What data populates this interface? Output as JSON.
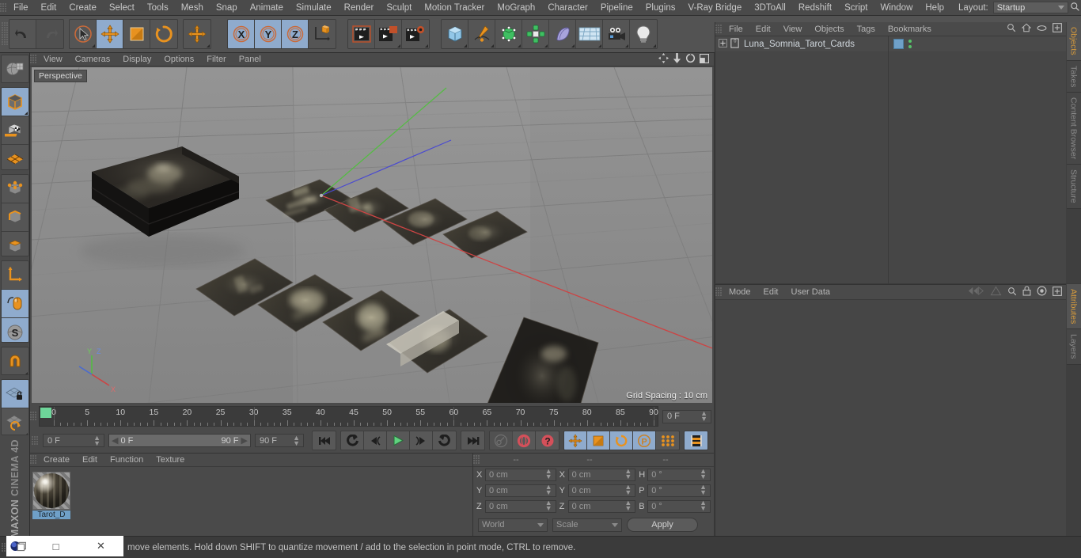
{
  "app": {
    "title": "MAXON CINEMA 4D",
    "brand_top": "MAXON",
    "brand_bottom": "CINEMA 4D"
  },
  "menubar": {
    "items": [
      "File",
      "Edit",
      "Create",
      "Select",
      "Tools",
      "Mesh",
      "Snap",
      "Animate",
      "Simulate",
      "Render",
      "Sculpt",
      "Motion Tracker",
      "MoGraph",
      "Character",
      "Pipeline",
      "Plugins",
      "V-Ray Bridge",
      "3DToAll",
      "Redshift",
      "Script",
      "Window",
      "Help"
    ],
    "layout_label": "Layout:",
    "layout_value": "Startup",
    "search_icon": "search-icon"
  },
  "toolbar": {
    "groups": [
      {
        "name": "history",
        "buttons": [
          {
            "name": "undo-button",
            "icon": "undo-icon",
            "state": "normal"
          },
          {
            "name": "redo-button",
            "icon": "redo-icon",
            "state": "disabled"
          }
        ]
      },
      {
        "name": "select-transform",
        "buttons": [
          {
            "name": "live-selection-button",
            "icon": "live-selection-icon",
            "state": "normal"
          },
          {
            "name": "move-button",
            "icon": "move-icon",
            "state": "active"
          },
          {
            "name": "scale-button",
            "icon": "scale-icon",
            "state": "normal"
          },
          {
            "name": "rotate-button",
            "icon": "rotate-icon",
            "state": "normal"
          }
        ]
      },
      {
        "name": "move-alt",
        "buttons": [
          {
            "name": "move-alt-button",
            "icon": "move-icon",
            "state": "normal"
          }
        ]
      },
      {
        "name": "axis-locks",
        "buttons": [
          {
            "name": "lock-x-button",
            "icon": "axis-x-icon",
            "state": "active"
          },
          {
            "name": "lock-y-button",
            "icon": "axis-y-icon",
            "state": "active"
          },
          {
            "name": "lock-z-button",
            "icon": "axis-z-icon",
            "state": "active"
          },
          {
            "name": "world-object-axis-button",
            "icon": "world-axis-icon",
            "state": "normal"
          }
        ]
      },
      {
        "name": "render",
        "buttons": [
          {
            "name": "render-view-button",
            "icon": "render-view-icon",
            "state": "normal"
          },
          {
            "name": "render-region-button",
            "icon": "render-region-icon",
            "state": "normal"
          },
          {
            "name": "render-settings-button",
            "icon": "render-settings-icon",
            "state": "normal"
          }
        ]
      },
      {
        "name": "create",
        "buttons": [
          {
            "name": "add-cube-button",
            "icon": "cube-icon",
            "state": "normal"
          },
          {
            "name": "add-spline-button",
            "icon": "pen-spline-icon",
            "state": "normal"
          },
          {
            "name": "add-generator-button",
            "icon": "generator-icon",
            "state": "normal"
          },
          {
            "name": "add-mograph-button",
            "icon": "mograph-icon",
            "state": "normal"
          },
          {
            "name": "add-deformer-button",
            "icon": "deformer-icon",
            "state": "normal"
          },
          {
            "name": "add-scene-button",
            "icon": "floor-icon",
            "state": "normal"
          },
          {
            "name": "add-camera-button",
            "icon": "camera-icon",
            "state": "normal"
          },
          {
            "name": "add-light-button",
            "icon": "light-bulb-icon",
            "state": "normal"
          }
        ]
      }
    ]
  },
  "left_toolbar": {
    "buttons": [
      {
        "name": "make-editable-button",
        "icon": "make-editable-icon",
        "state": "normal"
      },
      {
        "name": "model-mode-button",
        "icon": "model-mode-icon",
        "state": "active"
      },
      {
        "name": "texture-mode-button",
        "icon": "texture-mode-icon",
        "state": "normal"
      },
      {
        "name": "workplane-mode-button",
        "icon": "workplane-mode-icon",
        "state": "normal"
      },
      {
        "name": "points-mode-button",
        "icon": "points-mode-icon",
        "state": "normal"
      },
      {
        "name": "edges-mode-button",
        "icon": "edges-mode-icon",
        "state": "normal"
      },
      {
        "name": "polygons-mode-button",
        "icon": "polygons-mode-icon",
        "state": "normal"
      },
      {
        "name": "axis-mode-button",
        "icon": "axis-mode-icon",
        "state": "normal"
      },
      {
        "name": "enable-snapping-button",
        "icon": "mouse-snap-icon",
        "state": "active"
      },
      {
        "name": "snap-settings-button",
        "icon": "snap-s-icon",
        "state": "active"
      },
      {
        "name": "magnet-button",
        "icon": "magnet-icon",
        "state": "normal"
      },
      {
        "name": "lock-workplane-button",
        "icon": "workplane-lock-icon",
        "state": "active"
      },
      {
        "name": "planar-workplane-button",
        "icon": "workplane-rotate-icon",
        "state": "normal"
      }
    ]
  },
  "viewport": {
    "menu": [
      "View",
      "Cameras",
      "Display",
      "Options",
      "Filter",
      "Panel"
    ],
    "label": "Perspective",
    "grid_spacing": "Grid Spacing : 10 cm",
    "icons": [
      "pan-icon",
      "zoom-icon",
      "rotate-icon",
      "maximize-icon"
    ],
    "axis_colors": {
      "x": "#cc4444",
      "y": "#55bb44",
      "z": "#4a4ad0"
    },
    "background": "#8b8b8b",
    "scene_description": "Tarot card deck box and spread of dark tarot cards on grid floor"
  },
  "timeline": {
    "ticks": [
      0,
      5,
      10,
      15,
      20,
      25,
      30,
      35,
      40,
      45,
      50,
      55,
      60,
      65,
      70,
      75,
      80,
      85,
      90
    ],
    "min": 0,
    "max": 90,
    "current_frame_label": "0 F",
    "playhead_frame": 0
  },
  "transport": {
    "current_frame": "0 F",
    "range_start": "0 F",
    "range_end": "90 F",
    "end_frame": "90 F",
    "buttons": [
      {
        "name": "go-to-start-button",
        "icon": "go-to-start-icon",
        "state": "normal"
      },
      {
        "name": "previous-key-button",
        "icon": "previous-key-icon",
        "state": "normal"
      },
      {
        "name": "step-back-button",
        "icon": "step-back-icon",
        "state": "normal"
      },
      {
        "name": "play-button",
        "icon": "play-icon",
        "state": "normal"
      },
      {
        "name": "step-forward-button",
        "icon": "step-forward-icon",
        "state": "normal"
      },
      {
        "name": "next-key-button",
        "icon": "next-key-icon",
        "state": "normal"
      },
      {
        "name": "go-to-end-button",
        "icon": "go-to-end-icon",
        "state": "normal"
      },
      {
        "name": "record-active-objects-button",
        "icon": "key-icon",
        "state": "disabled"
      },
      {
        "name": "autokeying-button",
        "icon": "autokey-icon",
        "state": "normal"
      },
      {
        "name": "keyframe-selection-button",
        "icon": "question-icon",
        "state": "normal"
      },
      {
        "name": "position-key-button",
        "icon": "move-icon",
        "state": "active"
      },
      {
        "name": "scale-key-button",
        "icon": "scale-icon",
        "state": "active"
      },
      {
        "name": "rotation-key-button",
        "icon": "rotate-icon",
        "state": "active"
      },
      {
        "name": "pla-key-button",
        "icon": "pla-icon",
        "state": "active"
      },
      {
        "name": "point-level-animation-button",
        "icon": "dots-icon",
        "state": "normal"
      },
      {
        "name": "timeline-toggle-button",
        "icon": "filmstrip-icon",
        "state": "active"
      }
    ]
  },
  "material_manager": {
    "menu": [
      "Create",
      "Edit",
      "Function",
      "Texture"
    ],
    "materials": [
      {
        "name": "Tarot_D",
        "icon": "material-sphere-icon"
      }
    ]
  },
  "coordinates": {
    "headers": [
      "--",
      "--",
      "--"
    ],
    "rows": [
      {
        "pos_label": "X",
        "pos_value": "0 cm",
        "size_label": "X",
        "size_value": "0 cm",
        "rot_label": "H",
        "rot_value": "0 °"
      },
      {
        "pos_label": "Y",
        "pos_value": "0 cm",
        "size_label": "Y",
        "size_value": "0 cm",
        "rot_label": "P",
        "rot_value": "0 °"
      },
      {
        "pos_label": "Z",
        "pos_value": "0 cm",
        "size_label": "Z",
        "size_value": "0 cm",
        "rot_label": "B",
        "rot_value": "0 °"
      }
    ],
    "system": "World",
    "mode": "Scale",
    "apply_label": "Apply"
  },
  "object_manager": {
    "menu": [
      "File",
      "Edit",
      "View",
      "Objects",
      "Tags",
      "Bookmarks"
    ],
    "icons": [
      "search-icon",
      "home-icon",
      "ellipse-icon",
      "plus-box-icon"
    ],
    "objects": [
      {
        "name": "Luna_Somnia_Tarot_Cards",
        "icon": "null-object-icon",
        "tag_color": "#6fa0c8",
        "expandable": true
      }
    ]
  },
  "attribute_manager": {
    "menu": [
      "Mode",
      "Edit",
      "User Data"
    ],
    "icons": [
      "back-icon",
      "forward-icon",
      "search-icon",
      "lock-icon",
      "target-icon",
      "plus-box-icon"
    ]
  },
  "right_tabs_top": [
    {
      "label": "Objects",
      "selected": true
    },
    {
      "label": "Takes",
      "selected": false
    },
    {
      "label": "Content Browser",
      "selected": false
    },
    {
      "label": "Structure",
      "selected": false
    }
  ],
  "right_tabs_bottom": [
    {
      "label": "Attributes",
      "selected": true
    },
    {
      "label": "Layers",
      "selected": false
    }
  ],
  "status": {
    "message": "move elements. Hold down SHIFT to quantize movement / add to the selection in point mode, CTRL to remove."
  },
  "taskbar": {
    "icon": "window-icon",
    "maximize": "□",
    "close": "✕"
  }
}
